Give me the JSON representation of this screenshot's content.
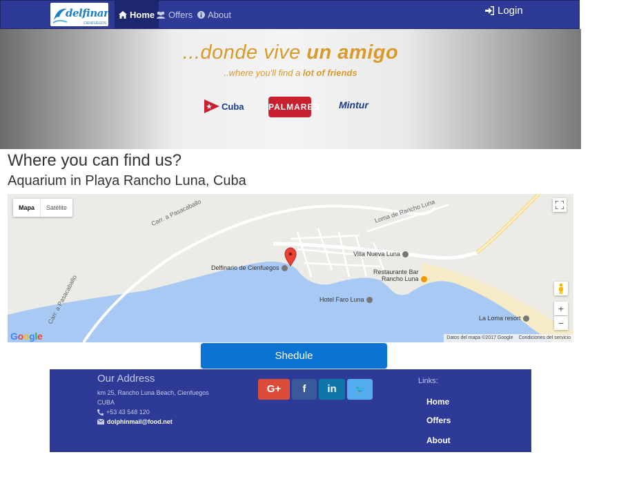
{
  "nav": {
    "logo_text": "delfinario",
    "logo_sub": "CIENFUEGOS",
    "items": [
      {
        "label": "Home",
        "icon": "home-icon"
      },
      {
        "label": "Offers",
        "icon": "users-icon"
      },
      {
        "label": "About",
        "icon": "info-icon"
      }
    ],
    "login_label": "Login"
  },
  "banner": {
    "tagline_light": "...donde vive ",
    "tagline_bold": "un amigo",
    "subtagline_light": "..where you'll find a ",
    "subtagline_bold": "lot of friends",
    "brands": [
      "Cuba",
      "PALMARES",
      "Mintur"
    ]
  },
  "headings": {
    "where": "Where you can find us?",
    "location": "Aquarium in Playa Rancho Luna, Cuba"
  },
  "map": {
    "type_options": [
      "Mapa",
      "Satélite"
    ],
    "selected_type": "Mapa",
    "labels": {
      "delfinario": "Delfinario de Cienfuegos",
      "villa": "Villa Nueva Luna",
      "restaurante_line1": "Restaurante Bar",
      "restaurante_line2": "Rancho Luna",
      "hotel": "Hotel Faro Luna",
      "loma_resort": "La Loma resort",
      "road_pasacaballo_1": "Carr. a Pasacaballo",
      "road_pasacaballo_2": "Carr. a Pasacaballo",
      "road_loma": "Loma de Rancho Luna"
    },
    "attribution": "Datos del mapa ©2017 Google",
    "terms": "Condiciones del servicio",
    "zoom_in": "+",
    "zoom_out": "−",
    "colors": {
      "water": "#a9c9f5",
      "land": "#ecebe6",
      "beach": "#f5ebc6",
      "road": "#ffffff",
      "pin": "#ea4335"
    }
  },
  "schedule_button": "Shedule",
  "footer": {
    "title": "Our Address",
    "address_line1": "km 25, Rancho Luna Beach, Cienfuegos",
    "address_line2": "CUBA",
    "phone": "+53 43 548 120",
    "email": "dolphinmail@food.net",
    "social": [
      {
        "label": "G+",
        "icon": "google-plus-icon"
      },
      {
        "label": "f",
        "icon": "facebook-icon"
      },
      {
        "label": "in",
        "icon": "linkedin-icon"
      },
      {
        "label": "🐦",
        "icon": "twitter-icon"
      }
    ],
    "links_title": "Links:",
    "links": [
      "Home",
      "Offers",
      "About"
    ]
  }
}
